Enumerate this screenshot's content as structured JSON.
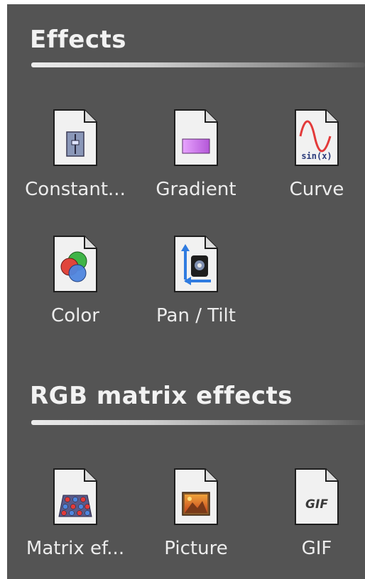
{
  "sections": [
    {
      "title": "Effects",
      "items": [
        {
          "label": "Constant...",
          "icon": "constant-fader-icon"
        },
        {
          "label": "Gradient",
          "icon": "gradient-icon"
        },
        {
          "label": "Curve",
          "icon": "sine-curve-icon",
          "icon_text": "sin(x)"
        },
        {
          "label": "Color",
          "icon": "color-circles-icon"
        },
        {
          "label": "Pan / Tilt",
          "icon": "pan-tilt-icon"
        }
      ]
    },
    {
      "title": "RGB matrix effects",
      "items": [
        {
          "label": "Matrix ef...",
          "icon": "rgb-matrix-icon"
        },
        {
          "label": "Picture",
          "icon": "picture-icon"
        },
        {
          "label": "GIF",
          "icon": "gif-icon",
          "icon_text": "GIF"
        }
      ]
    }
  ],
  "colors": {
    "panel_background": "#545454",
    "text": "#ececec",
    "gradient_swatch": "#d27cf0",
    "curve": "#e33a3a"
  }
}
